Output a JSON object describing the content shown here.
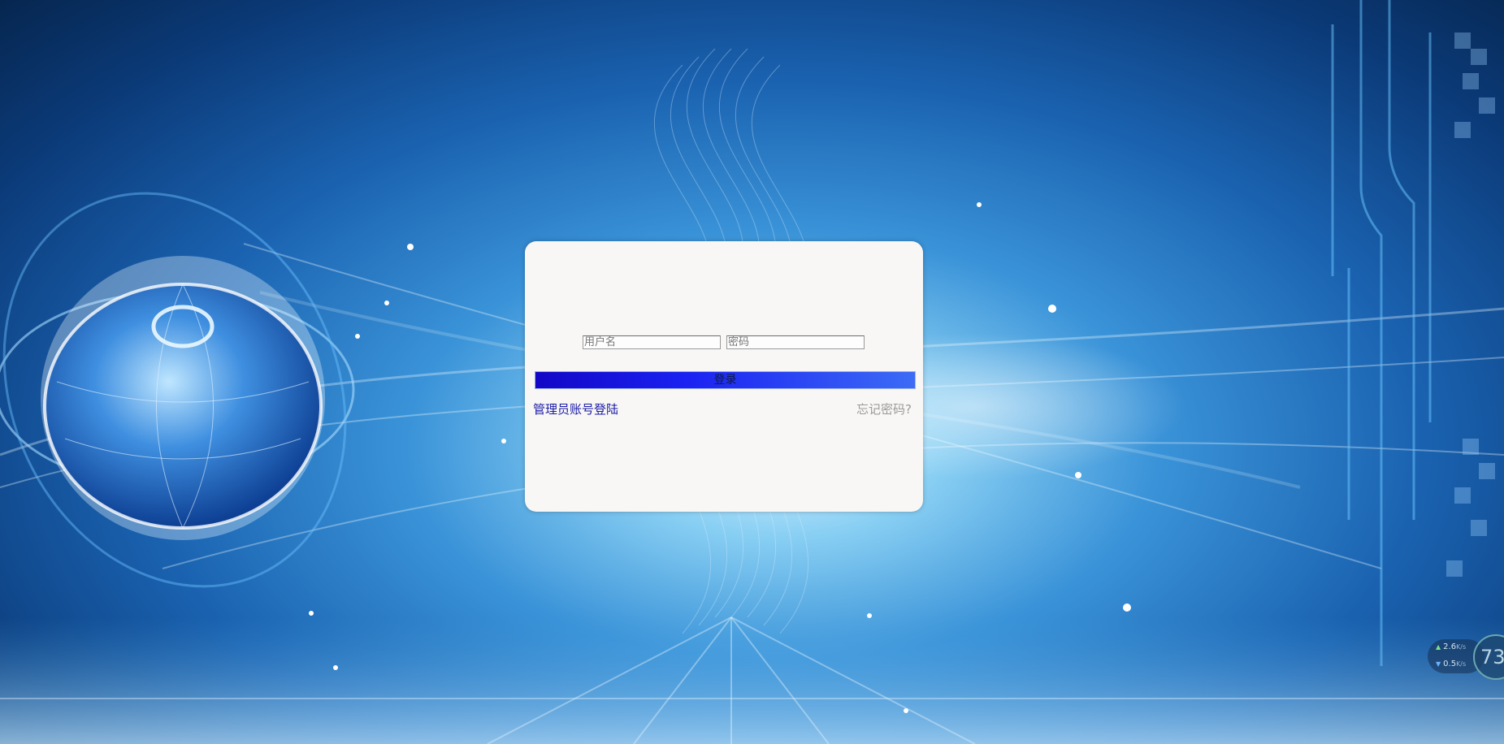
{
  "login": {
    "username_placeholder": "用户名",
    "password_placeholder": "密码",
    "login_button": "登录",
    "admin_link": "管理员账号登陆",
    "forgot_link": "忘记密码?"
  },
  "network_widget": {
    "upload_speed": "2.6",
    "download_speed": "0.5",
    "unit": "K/s",
    "gauge_value": "73"
  },
  "colors": {
    "background_primary": "#1a62b0",
    "card_background": "#f8f7f5",
    "button_gradient_start": "#1307c6",
    "button_gradient_end": "#3c6cf6",
    "admin_link": "#1a1aa6",
    "forgot_link": "#9a9a9a"
  }
}
